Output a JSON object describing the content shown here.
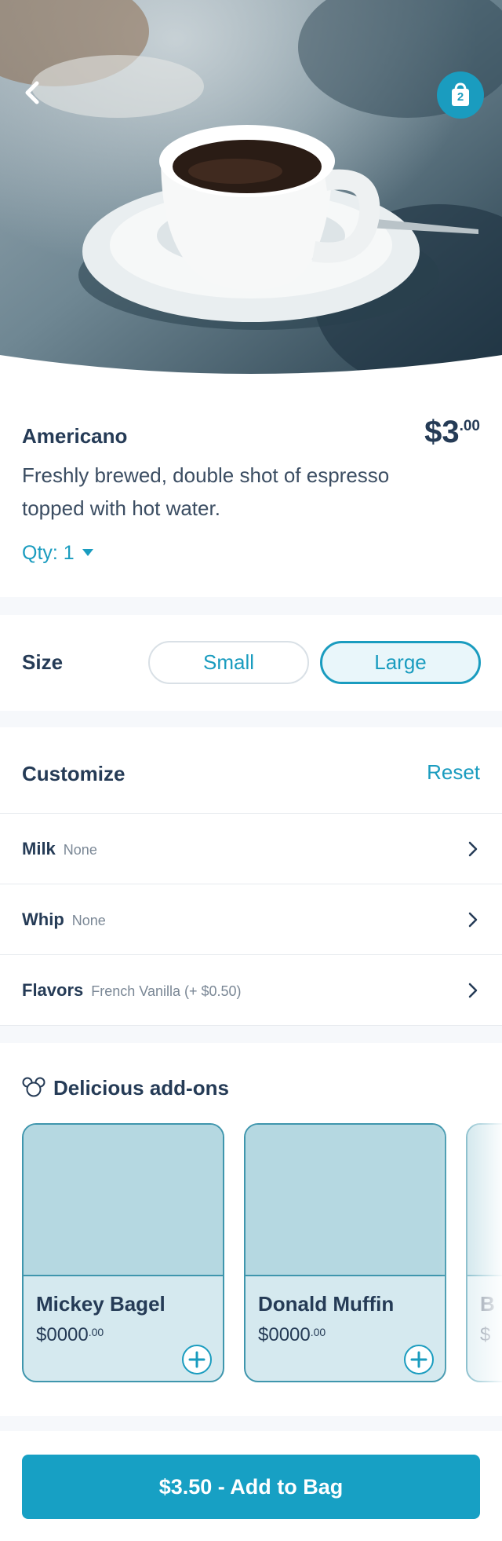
{
  "header": {
    "back_icon": "chevron-left-icon",
    "bag_icon": "shopping-bag-icon",
    "bag_count": "2",
    "accent": "#1a9cbf"
  },
  "product": {
    "name": "Americano",
    "price_dollars": "$3",
    "price_cents": ".00",
    "description": "Freshly brewed, double shot of espresso topped with hot water.",
    "qty_label": "Qty: 1"
  },
  "size": {
    "label": "Size",
    "options": [
      "Small",
      "Large"
    ],
    "selected": "Large"
  },
  "customize": {
    "title": "Customize",
    "reset_label": "Reset",
    "options": [
      {
        "label": "Milk",
        "value": "None"
      },
      {
        "label": "Whip",
        "value": "None"
      },
      {
        "label": "Flavors",
        "value": "French Vanilla (+ $0.50)"
      }
    ]
  },
  "addons": {
    "title": "Delicious add-ons",
    "items": [
      {
        "name": "Mickey Bagel",
        "price": "$0000",
        "cents": ".00"
      },
      {
        "name": "Donald Muffin",
        "price": "$0000",
        "cents": ".00"
      },
      {
        "name": "B",
        "price": "$",
        "cents": ""
      }
    ]
  },
  "footer": {
    "cta_label": "$3.50 - Add to Bag"
  }
}
